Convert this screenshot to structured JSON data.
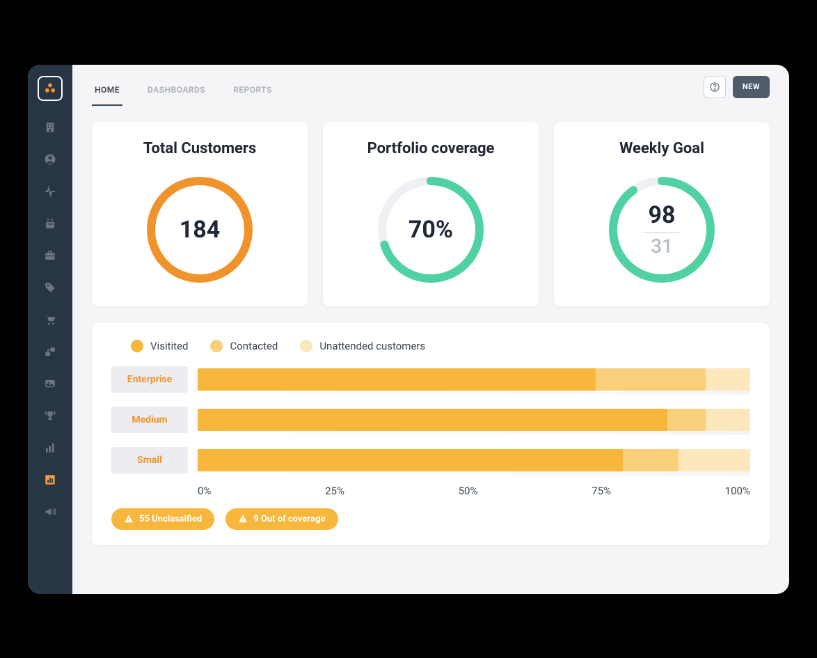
{
  "tabs": {
    "home": "HOME",
    "dashboards": "DASHBOARDS",
    "reports": "REPORTS"
  },
  "buttons": {
    "new": "NEW"
  },
  "cards": {
    "total": {
      "title": "Total Customers",
      "value": "184"
    },
    "coverage": {
      "title": "Portfolio coverage",
      "value": "70%"
    },
    "goal": {
      "title": "Weekly Goal",
      "value": "98",
      "sub": "31"
    }
  },
  "legend": {
    "visited": "Visitited",
    "contacted": "Contacted",
    "unattended": "Unattended customers"
  },
  "segments": {
    "enterprise": {
      "label": "Enterprise"
    },
    "medium": {
      "label": "Medium"
    },
    "small": {
      "label": "Small"
    }
  },
  "axis": {
    "t0": "0%",
    "t25": "25%",
    "t50": "50%",
    "t75": "75%",
    "t100": "100%"
  },
  "alerts": {
    "unclassified": "55 Unclassified",
    "outofcoverage": "9 Out of coverage"
  },
  "colors": {
    "orange": "#f0932b",
    "green": "#4fd1a1",
    "bar1": "#f6b73c",
    "bar2": "#f9cf7a",
    "bar3": "#fde8bd"
  },
  "chart_data": {
    "type": "bar",
    "title": "Customer coverage by segment",
    "xlabel": "",
    "ylabel": "",
    "ylim": [
      0,
      100
    ],
    "categories": [
      "Enterprise",
      "Medium",
      "Small"
    ],
    "series": [
      {
        "name": "Visitited",
        "values": [
          72,
          85,
          77
        ]
      },
      {
        "name": "Contacted",
        "values": [
          20,
          7,
          10
        ]
      },
      {
        "name": "Unattended customers",
        "values": [
          8,
          8,
          13
        ]
      }
    ],
    "rings": [
      {
        "name": "Total Customers",
        "value": 184,
        "percent": 100,
        "color": "#f0932b"
      },
      {
        "name": "Portfolio coverage",
        "value": 70,
        "percent": 70,
        "color": "#4fd1a1"
      },
      {
        "name": "Weekly Goal",
        "value": 98,
        "target": 31,
        "percent": 90,
        "color": "#4fd1a1"
      }
    ]
  }
}
